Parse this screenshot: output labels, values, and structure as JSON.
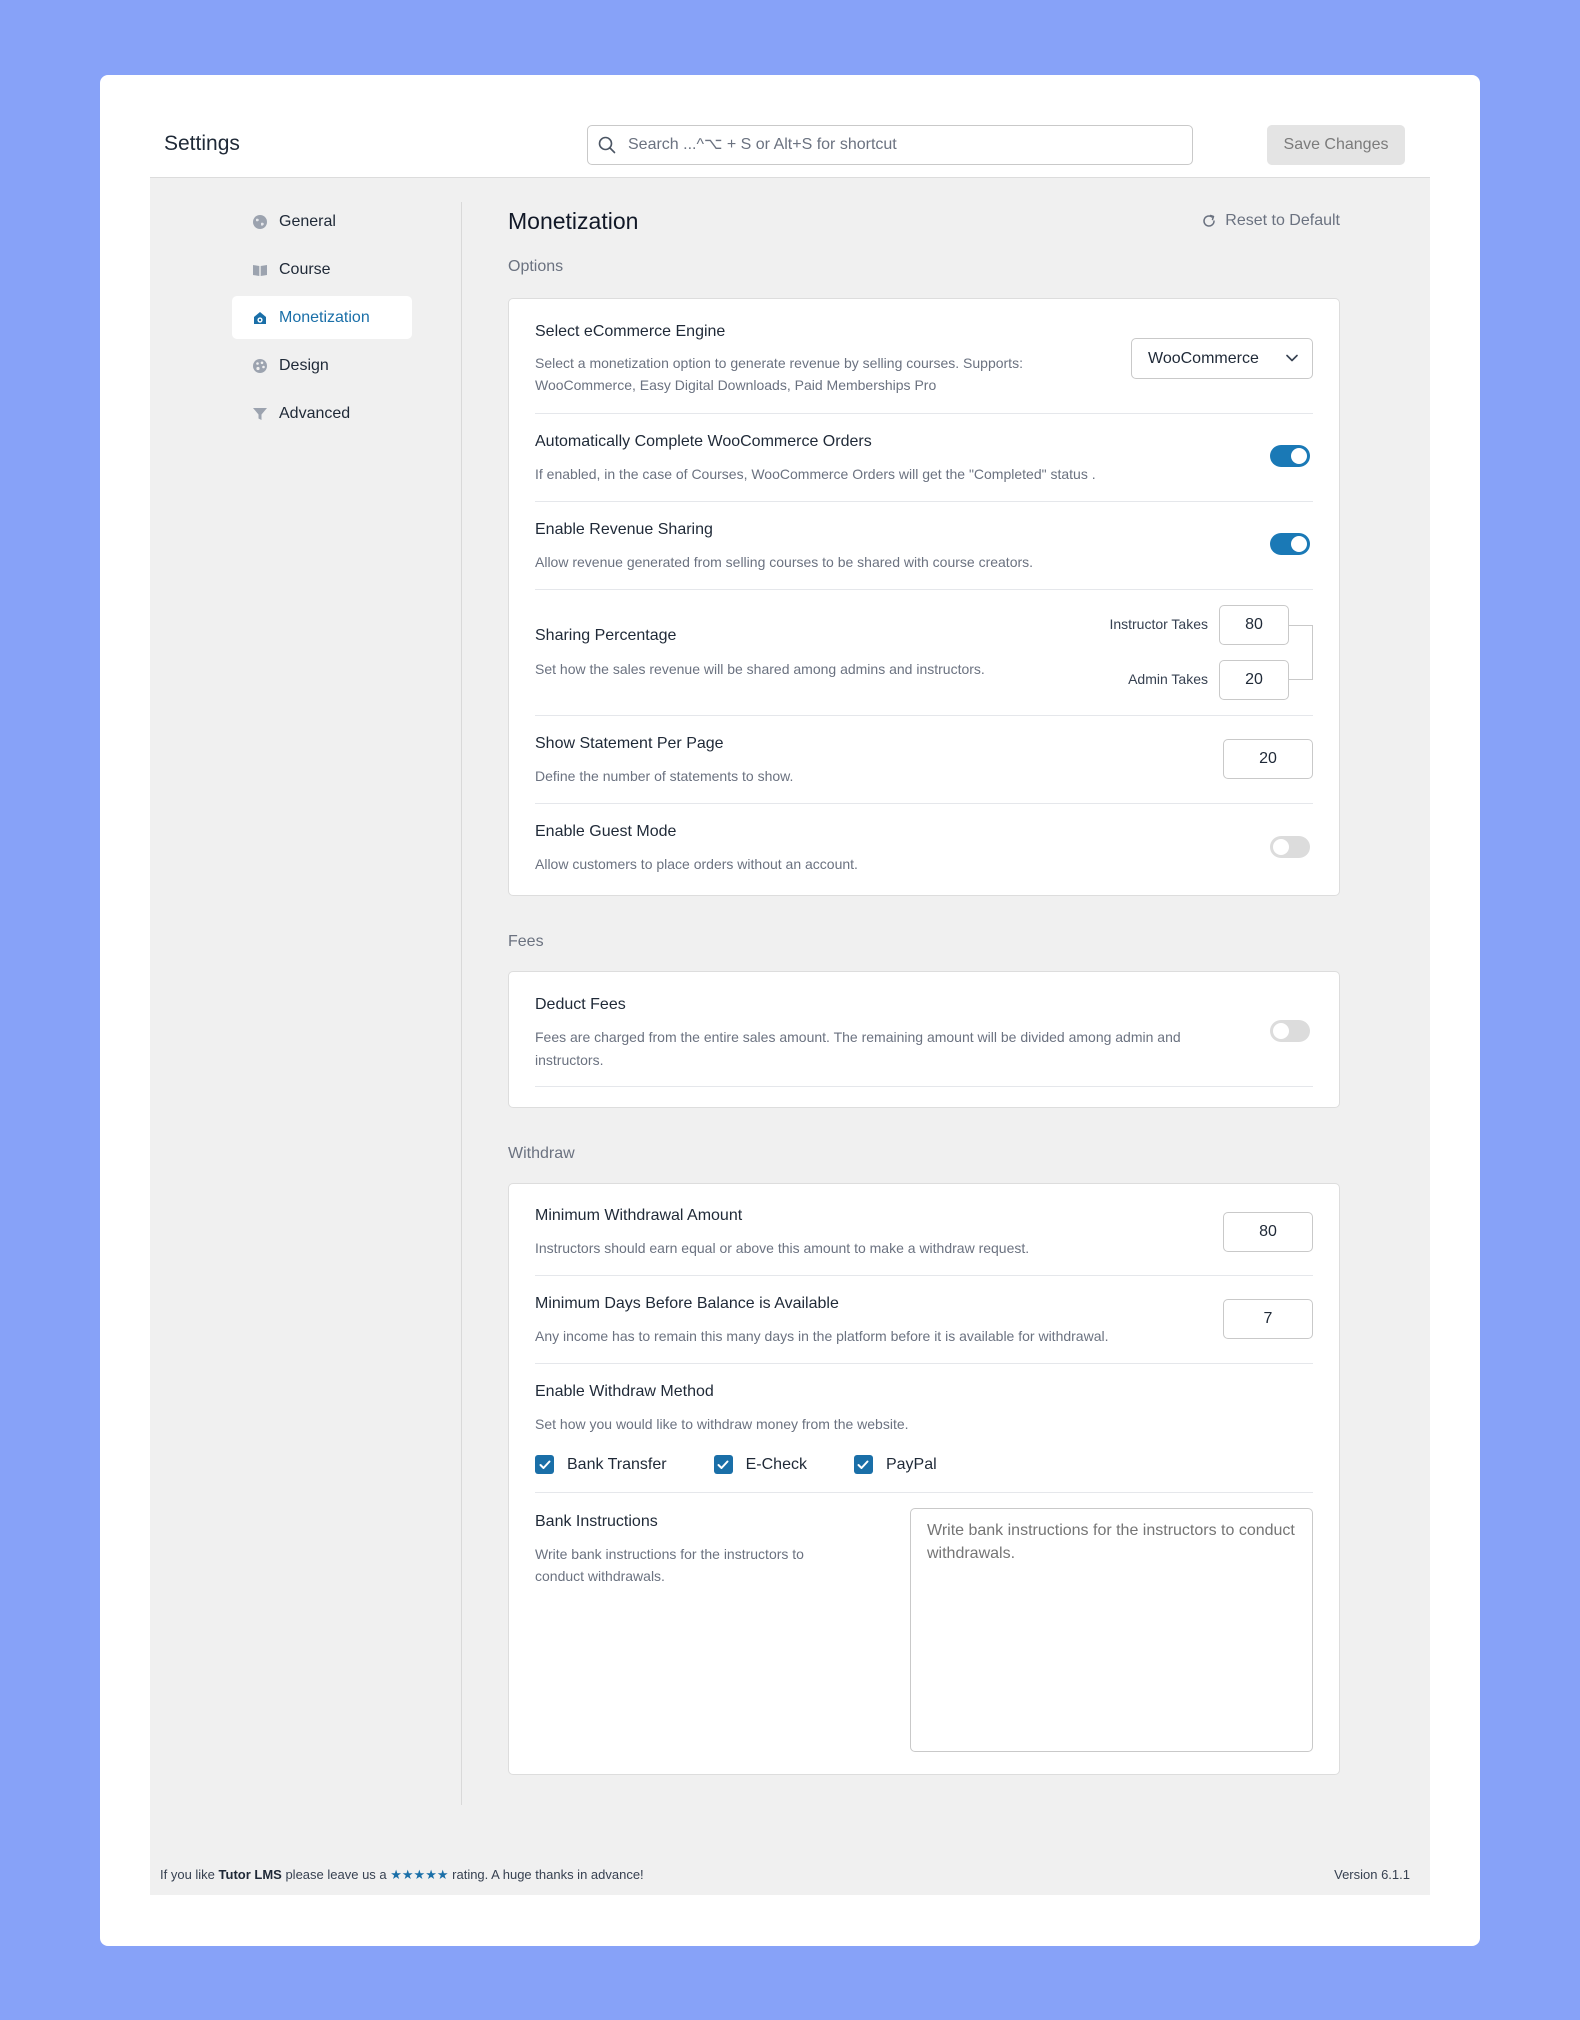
{
  "header": {
    "title": "Settings",
    "search_placeholder": "Search ...^⌥ + S or Alt+S for shortcut",
    "save_label": "Save Changes"
  },
  "sidebar": {
    "items": [
      {
        "label": "General",
        "icon": "globe-icon"
      },
      {
        "label": "Course",
        "icon": "book-icon"
      },
      {
        "label": "Monetization",
        "icon": "monetization-icon",
        "active": true
      },
      {
        "label": "Design",
        "icon": "palette-icon"
      },
      {
        "label": "Advanced",
        "icon": "filter-icon"
      }
    ]
  },
  "page": {
    "title": "Monetization",
    "reset_label": "Reset to Default"
  },
  "options": {
    "section_label": "Options",
    "ecommerce": {
      "title": "Select eCommerce Engine",
      "desc_line1": "Select a monetization option to generate revenue by selling courses. Supports:",
      "desc_line2": "WooCommerce, Easy Digital Downloads, Paid Memberships Pro",
      "value": "WooCommerce"
    },
    "auto_complete": {
      "title": "Automatically Complete WooCommerce Orders",
      "desc": "If enabled, in the case of Courses, WooCommerce Orders will get the \"Completed\" status .",
      "enabled": true
    },
    "revenue_sharing": {
      "title": "Enable Revenue Sharing",
      "desc": "Allow revenue generated from selling courses to be shared with course creators.",
      "enabled": true
    },
    "sharing_percentage": {
      "title": "Sharing Percentage",
      "desc": "Set how the sales revenue will be shared among admins and instructors.",
      "instructor_label": "Instructor Takes",
      "instructor_value": "80",
      "admin_label": "Admin Takes",
      "admin_value": "20"
    },
    "statement_per_page": {
      "title": "Show Statement Per Page",
      "desc": "Define the number of statements to show.",
      "value": "20"
    },
    "guest_mode": {
      "title": "Enable Guest Mode",
      "desc": "Allow customers to place orders without an account.",
      "enabled": false
    }
  },
  "fees": {
    "section_label": "Fees",
    "deduct": {
      "title": "Deduct Fees",
      "desc_line1": "Fees are charged from the entire sales amount. The remaining amount will be divided among admin and",
      "desc_line2": "instructors.",
      "enabled": false
    }
  },
  "withdraw": {
    "section_label": "Withdraw",
    "min_amount": {
      "title": "Minimum Withdrawal Amount",
      "desc": "Instructors should earn equal or above this amount to make a withdraw request.",
      "value": "80"
    },
    "min_days": {
      "title": "Minimum Days Before Balance is Available",
      "desc": "Any income has to remain this many days in the platform before it is available for withdrawal.",
      "value": "7"
    },
    "methods": {
      "title": "Enable Withdraw Method",
      "desc": "Set how you would like to withdraw money from the website.",
      "options": [
        {
          "label": "Bank Transfer",
          "checked": true
        },
        {
          "label": "E-Check",
          "checked": true
        },
        {
          "label": "PayPal",
          "checked": true
        }
      ]
    },
    "bank_instructions": {
      "title": "Bank Instructions",
      "desc_line1": "Write bank instructions for the instructors to",
      "desc_line2": "conduct withdrawals.",
      "placeholder": "Write bank instructions for the instructors to conduct withdrawals."
    }
  },
  "footer": {
    "text_before": "If you like ",
    "brand": "Tutor LMS",
    "text_middle": " please leave us a ",
    "stars": "★★★★★",
    "text_after": " rating. A huge thanks in advance!",
    "version": "Version 6.1.1"
  },
  "colors": {
    "background": "#87a2f8",
    "accent": "#1a6fa8",
    "toggle_on": "#1a79b6"
  }
}
